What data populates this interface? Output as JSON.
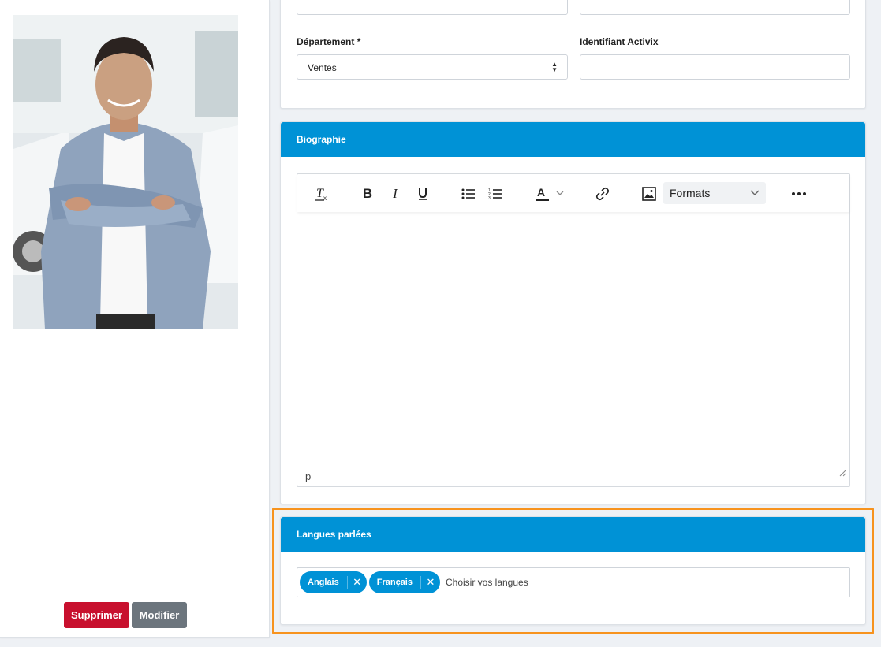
{
  "profile": {
    "delete_label": "Supprimer",
    "edit_label": "Modifier"
  },
  "form": {
    "department_label": "Département *",
    "department_value": "Ventes",
    "activix_label": "Identifiant Activix",
    "activix_value": ""
  },
  "biography": {
    "title": "Biographie",
    "formats_label": "Formats",
    "status_path": "p"
  },
  "languages": {
    "title": "Langues parlées",
    "tags": [
      "Anglais",
      "Français"
    ],
    "placeholder": "Choisir vos langues"
  },
  "colors": {
    "header": "#0092d6",
    "delete": "#c8102e",
    "edit": "#6c757d",
    "highlight": "#f7931e"
  }
}
